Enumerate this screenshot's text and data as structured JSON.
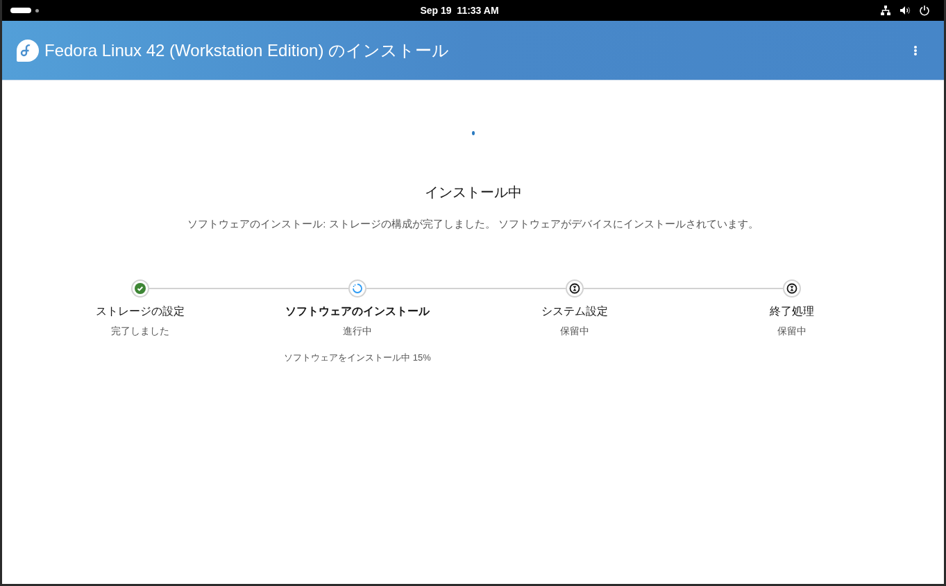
{
  "top_bar": {
    "clock": "Sep 19  11:33 AM"
  },
  "header": {
    "title": "Fedora Linux 42 (Workstation Edition) のインストール"
  },
  "main": {
    "heading": "インストール中",
    "description": "ソフトウェアのインストール: ストレージの構成が完了しました。 ソフトウェアがデバイスにインストールされています。"
  },
  "steps": [
    {
      "kind": "done",
      "title": "ストレージの設定",
      "status": "完了しました",
      "selected": false
    },
    {
      "kind": "active",
      "title": "ソフトウェアのインストール",
      "status": "進行中",
      "detail": "ソフトウェアをインストール中 15%",
      "selected": true
    },
    {
      "kind": "pending",
      "title": "システム設定",
      "status": "保留中",
      "selected": false
    },
    {
      "kind": "pending",
      "title": "終了処理",
      "status": "保留中",
      "selected": false
    }
  ]
}
